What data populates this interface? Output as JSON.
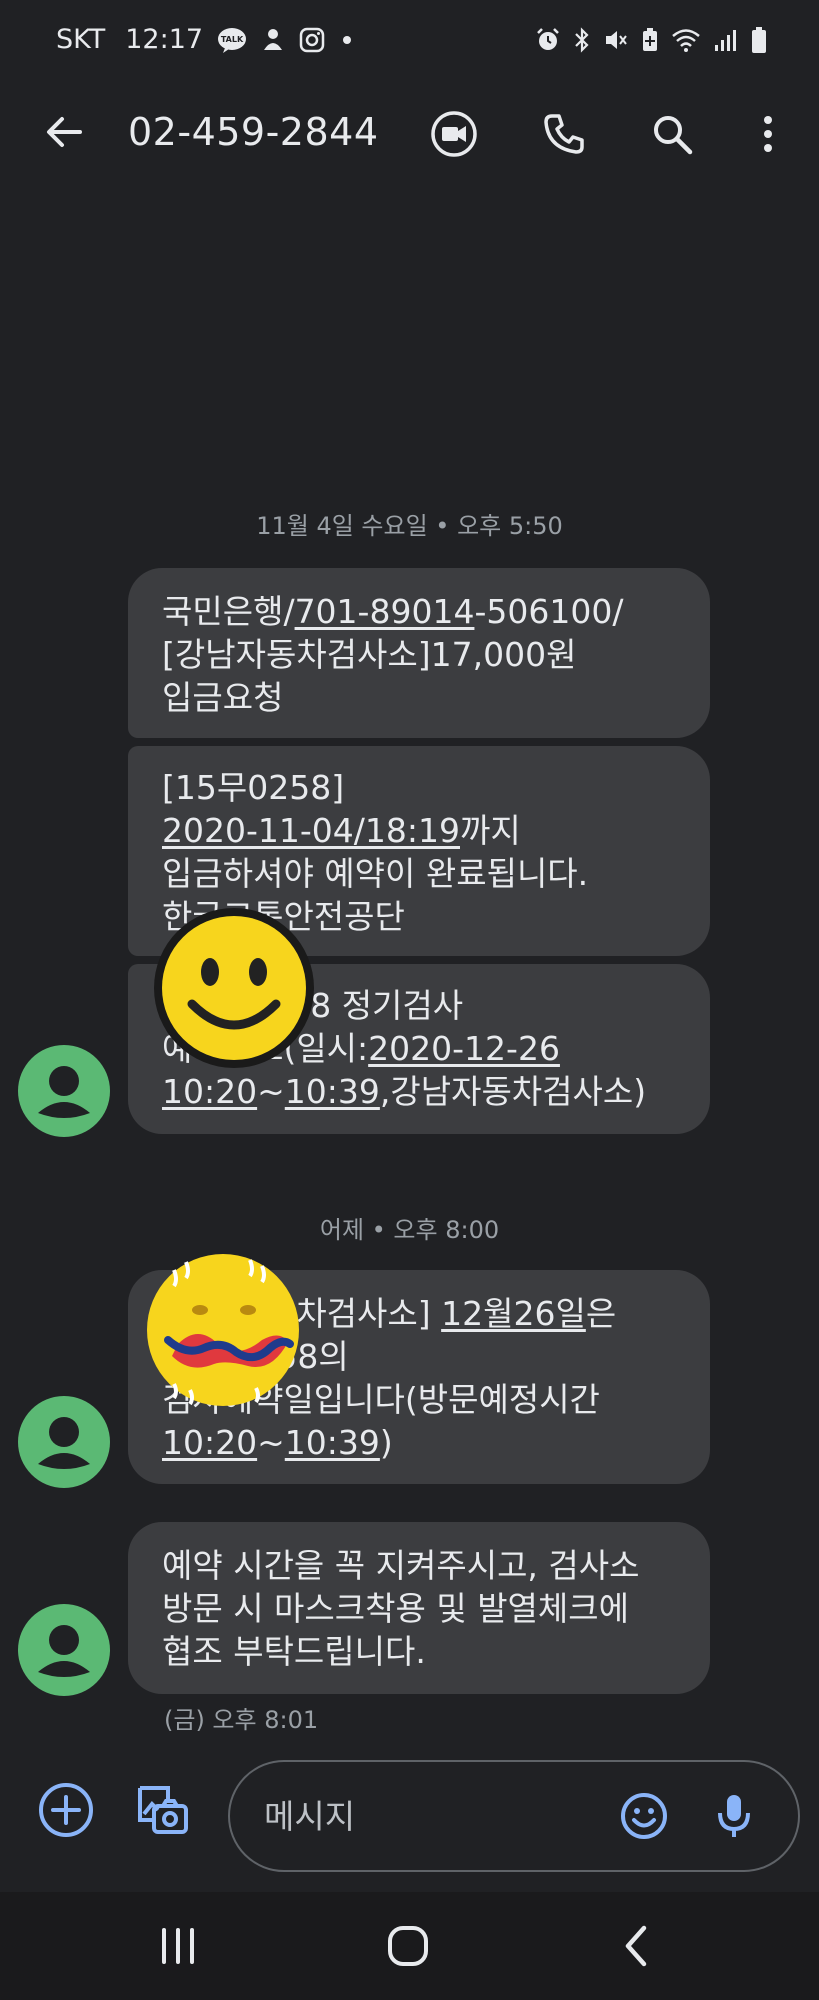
{
  "status_bar": {
    "carrier": "SKT",
    "time": "12:17",
    "left_icons": [
      "kakaotalk-icon",
      "notification-icon",
      "instagram-icon",
      "more-dot-icon"
    ],
    "right_icons": [
      "alarm-icon",
      "bluetooth-icon",
      "mute-icon",
      "battery-saver-icon",
      "wifi-icon",
      "signal-icon",
      "battery-icon"
    ],
    "kakao_label": "TALK"
  },
  "app_bar": {
    "title": "02-459-2844",
    "icons": [
      "back-arrow-icon",
      "video-call-icon",
      "phone-icon",
      "search-icon",
      "more-vert-icon"
    ]
  },
  "conversation": {
    "date_1": "11월 4일 수요일 • 오후 5:50",
    "date_2": "어제 • 오후 8:00",
    "messages": [
      {
        "line_1_a": "국민은행/",
        "line_1_b": "701-89014",
        "line_1_c": "-506100/",
        "line_2": "[강남자동차검사소]17,000원",
        "line_3": "입금요청"
      },
      {
        "line_1": "[15무0258]",
        "line_2_a": "2020-11-04/18:19",
        "line_2_b": "까지",
        "line_3": "입금하셔야 예약이 완료됩니다.",
        "line_4": "한국교통안전공단"
      },
      {
        "line_1": "[15무0258 정기검사",
        "line_2_a": "예약완료(일시:",
        "line_2_b": "2020-12-26",
        "line_3_a": "10:20",
        "line_3_b": "~",
        "line_3_c": "10:39",
        "line_3_d": ",강남자동차검사소)"
      },
      {
        "line_1_a": "[강남자동차검사소] ",
        "line_1_b": "12월26일",
        "line_1_c": "은",
        "line_2": "15무0258의",
        "line_3": "검사예약일입니다(방문예정시간",
        "line_4_a": "10:20",
        "line_4_b": "~",
        "line_4_c": "10:39",
        "line_4_d": ")"
      },
      {
        "line_1": "예약 시간을 꼭 지켜주시고, 검사소",
        "line_2": "방문 시 마스크착용 및 발열체크에",
        "line_3": "협조 부탁드립니다."
      }
    ],
    "last_timestamp": "(금) 오후 8:01"
  },
  "compose": {
    "placeholder": "메시지",
    "icons": [
      "add-circle-icon",
      "gallery-camera-icon",
      "emoji-icon",
      "microphone-icon"
    ]
  },
  "nav_bar": {
    "icons": [
      "recent-apps-icon",
      "home-icon",
      "back-icon"
    ]
  },
  "colors": {
    "background": "#202124",
    "bubble": "#3c3d40",
    "avatar": "#5bb974",
    "accent_blue": "#8ab4f8",
    "secondary_text": "#9aa0a6"
  }
}
